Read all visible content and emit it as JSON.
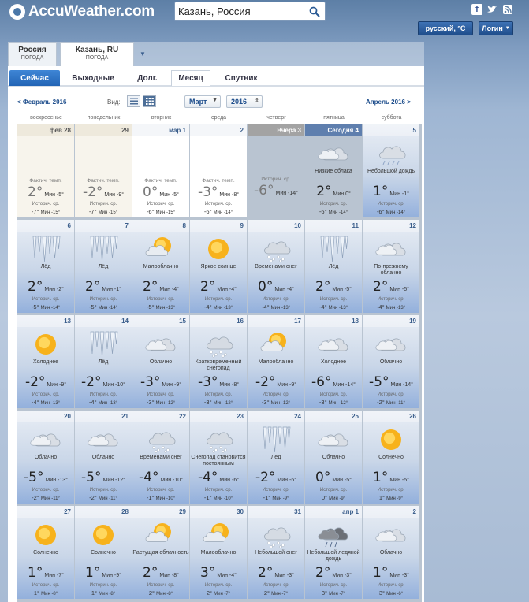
{
  "header": {
    "logo_text": "AccuWeather.com",
    "search_value": "Казань, Россия",
    "language_button": "русский, °C",
    "login_button": "Логин"
  },
  "locations": [
    {
      "name": "Россия",
      "sub": "ПОГОДА"
    },
    {
      "name": "Казань, RU",
      "sub": "ПОГОДА"
    }
  ],
  "tabs": [
    "Сейчас",
    "Выходные",
    "Долг.",
    "Месяц",
    "Спутник"
  ],
  "month_nav": {
    "prev": "< Февраль 2016",
    "view_label": "Вид:",
    "month": "Март",
    "year": "2016",
    "next": "Апрель 2016 >"
  },
  "weekdays": [
    "воскресенье",
    "понедельник",
    "вторник",
    "среда",
    "четверг",
    "пятница",
    "суббота"
  ],
  "labels": {
    "actual_temp": "Фактич. темп.",
    "historical_avg": "Историч. ср.",
    "min": "Мин"
  },
  "days": [
    {
      "date": "фев 28",
      "state": "past",
      "hi": "2°",
      "lo": "-5°",
      "avg_hi": "-7°",
      "avg_lo": "-15°"
    },
    {
      "date": "29",
      "state": "past",
      "hi": "-2°",
      "lo": "-9°",
      "avg_hi": "-7°",
      "avg_lo": "-15°"
    },
    {
      "date": "мар 1",
      "state": "mar1",
      "hi": "0°",
      "lo": "-5°",
      "avg_hi": "-6°",
      "avg_lo": "-15°"
    },
    {
      "date": "2",
      "state": "mar1",
      "hi": "-3°",
      "lo": "-8°",
      "avg_hi": "-6°",
      "avg_lo": "-14°"
    },
    {
      "date": "Вчера 3",
      "state": "yest",
      "hi": "-6°",
      "lo": "-14°",
      "avg_hi": "",
      "avg_lo": ""
    },
    {
      "date": "Сегодня 4",
      "state": "today",
      "icon": "cloud",
      "desc": "Низкие облака",
      "hi": "2°",
      "lo": "0°",
      "avg_hi": "-6°",
      "avg_lo": "-14°"
    },
    {
      "date": "5",
      "state": "future",
      "icon": "rain-cloud",
      "desc": "Небольшой дождь",
      "hi": "1°",
      "lo": "-1°",
      "avg_hi": "-6°",
      "avg_lo": "-14°"
    },
    {
      "date": "6",
      "state": "future",
      "icon": "ice",
      "desc": "Лёд",
      "hi": "2°",
      "lo": "-2°",
      "avg_hi": "-5°",
      "avg_lo": "-14°"
    },
    {
      "date": "7",
      "state": "future",
      "icon": "ice",
      "desc": "Лёд",
      "hi": "2°",
      "lo": "-1°",
      "avg_hi": "-5°",
      "avg_lo": "-14°"
    },
    {
      "date": "8",
      "state": "future",
      "icon": "sun-cloud",
      "desc": "Малооблачно",
      "hi": "2°",
      "lo": "-4°",
      "avg_hi": "-5°",
      "avg_lo": "-13°"
    },
    {
      "date": "9",
      "state": "future",
      "icon": "sun",
      "desc": "Яркое солнце",
      "hi": "2°",
      "lo": "-4°",
      "avg_hi": "-4°",
      "avg_lo": "-13°"
    },
    {
      "date": "10",
      "state": "future",
      "icon": "snow-cloud",
      "desc": "Временами снег",
      "hi": "0°",
      "lo": "-4°",
      "avg_hi": "-4°",
      "avg_lo": "-13°"
    },
    {
      "date": "11",
      "state": "future",
      "icon": "ice",
      "desc": "Лёд",
      "hi": "2°",
      "lo": "-5°",
      "avg_hi": "-4°",
      "avg_lo": "-13°"
    },
    {
      "date": "12",
      "state": "future",
      "icon": "cloud",
      "desc": "По-прежнему облачно",
      "hi": "2°",
      "lo": "-5°",
      "avg_hi": "-4°",
      "avg_lo": "-13°"
    },
    {
      "date": "13",
      "state": "future",
      "icon": "sun",
      "desc": "Холоднее",
      "hi": "-2°",
      "lo": "-9°",
      "avg_hi": "-4°",
      "avg_lo": "-13°"
    },
    {
      "date": "14",
      "state": "future",
      "icon": "ice",
      "desc": "Лёд",
      "hi": "-2°",
      "lo": "-10°",
      "avg_hi": "-4°",
      "avg_lo": "-13°"
    },
    {
      "date": "15",
      "state": "future",
      "icon": "cloud",
      "desc": "Облачно",
      "hi": "-3°",
      "lo": "-9°",
      "avg_hi": "-3°",
      "avg_lo": "-12°"
    },
    {
      "date": "16",
      "state": "future",
      "icon": "snow-cloud",
      "desc": "Кратковременный снегопад",
      "hi": "-3°",
      "lo": "-8°",
      "avg_hi": "-3°",
      "avg_lo": "-12°"
    },
    {
      "date": "17",
      "state": "future",
      "icon": "sun-cloud",
      "desc": "Малооблачно",
      "hi": "-2°",
      "lo": "-9°",
      "avg_hi": "-3°",
      "avg_lo": "-12°"
    },
    {
      "date": "18",
      "state": "future",
      "icon": "cloud",
      "desc": "Холоднее",
      "hi": "-6°",
      "lo": "-14°",
      "avg_hi": "-3°",
      "avg_lo": "-12°"
    },
    {
      "date": "19",
      "state": "future",
      "icon": "cloud",
      "desc": "Облачно",
      "hi": "-5°",
      "lo": "-14°",
      "avg_hi": "-2°",
      "avg_lo": "-11°"
    },
    {
      "date": "20",
      "state": "future",
      "icon": "cloud",
      "desc": "Облачно",
      "hi": "-5°",
      "lo": "-13°",
      "avg_hi": "-2°",
      "avg_lo": "-11°"
    },
    {
      "date": "21",
      "state": "future",
      "icon": "cloud",
      "desc": "Облачно",
      "hi": "-5°",
      "lo": "-12°",
      "avg_hi": "-2°",
      "avg_lo": "-11°"
    },
    {
      "date": "22",
      "state": "future",
      "icon": "snow-cloud",
      "desc": "Временами снег",
      "hi": "-4°",
      "lo": "-10°",
      "avg_hi": "-1°",
      "avg_lo": "-10°"
    },
    {
      "date": "23",
      "state": "future",
      "icon": "snow-cloud",
      "desc": "Снегопад становится постоянным",
      "hi": "-4°",
      "lo": "-6°",
      "avg_hi": "-1°",
      "avg_lo": "-10°"
    },
    {
      "date": "24",
      "state": "future",
      "icon": "ice",
      "desc": "Лёд",
      "hi": "-2°",
      "lo": "-6°",
      "avg_hi": "-1°",
      "avg_lo": "-9°"
    },
    {
      "date": "25",
      "state": "future",
      "icon": "cloud",
      "desc": "Облачно",
      "hi": "0°",
      "lo": "-5°",
      "avg_hi": "0°",
      "avg_lo": "-9°"
    },
    {
      "date": "26",
      "state": "future",
      "icon": "sun",
      "desc": "Солнечно",
      "hi": "1°",
      "lo": "-5°",
      "avg_hi": "1°",
      "avg_lo": "-9°"
    },
    {
      "date": "27",
      "state": "future",
      "icon": "sun",
      "desc": "Солнечно",
      "hi": "1°",
      "lo": "-7°",
      "avg_hi": "1°",
      "avg_lo": "-8°"
    },
    {
      "date": "28",
      "state": "future",
      "icon": "sun",
      "desc": "Солнечно",
      "hi": "1°",
      "lo": "-9°",
      "avg_hi": "1°",
      "avg_lo": "-8°"
    },
    {
      "date": "29",
      "state": "future",
      "icon": "sun-cloud",
      "desc": "Растущая облачность",
      "hi": "2°",
      "lo": "-8°",
      "avg_hi": "2°",
      "avg_lo": "-8°"
    },
    {
      "date": "30",
      "state": "future",
      "icon": "sun-cloud",
      "desc": "Малооблачно",
      "hi": "3°",
      "lo": "-4°",
      "avg_hi": "2°",
      "avg_lo": "-7°"
    },
    {
      "date": "31",
      "state": "future",
      "icon": "snow-cloud",
      "desc": "Небольшой снег",
      "hi": "2°",
      "lo": "-3°",
      "avg_hi": "2°",
      "avg_lo": "-7°"
    },
    {
      "date": "апр 1",
      "state": "future",
      "icon": "dark-rain",
      "desc": "Небольшой ледяной дождь",
      "hi": "2°",
      "lo": "-3°",
      "avg_hi": "3°",
      "avg_lo": "-7°"
    },
    {
      "date": "2",
      "state": "future",
      "icon": "cloud",
      "desc": "Облачно",
      "hi": "1°",
      "lo": "-3°",
      "avg_hi": "3°",
      "avg_lo": "-6°"
    }
  ]
}
